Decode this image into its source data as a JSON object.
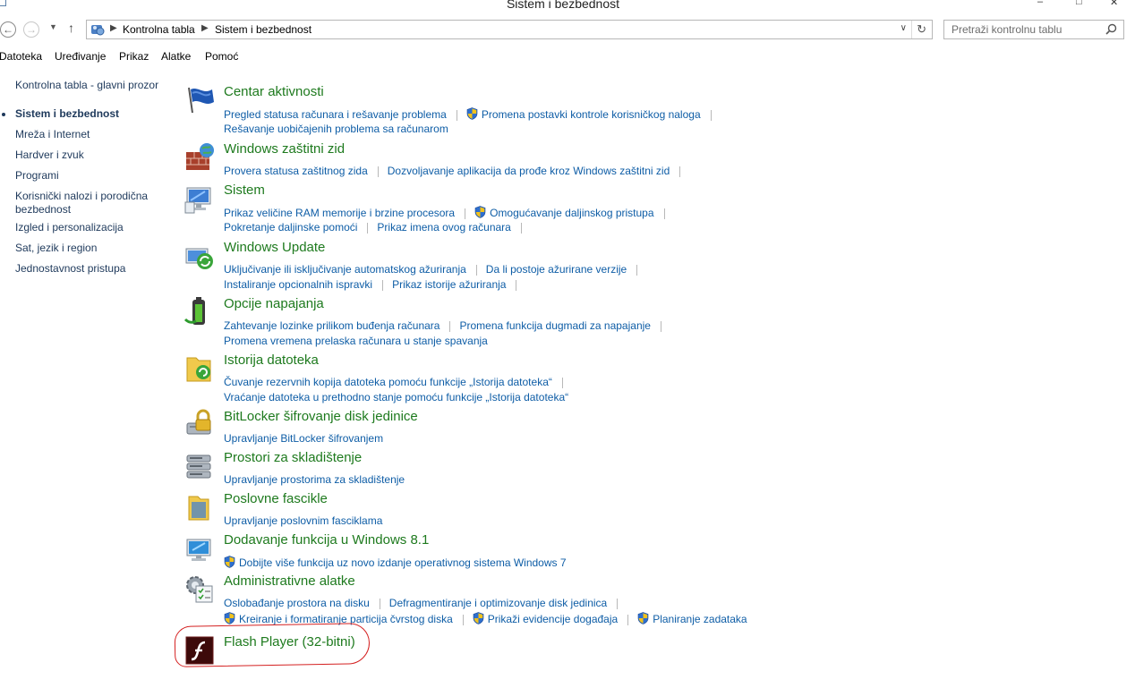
{
  "window": {
    "title": "Sistem i bezbednost",
    "controls": [
      "–",
      "□",
      "✕"
    ]
  },
  "address": {
    "crumbs": [
      "Kontrolna tabla",
      "Sistem i bezbednost"
    ],
    "separator": "▶",
    "dropdown": "∨",
    "refresh": "↻"
  },
  "search": {
    "placeholder": "Pretraži kontrolnu tablu"
  },
  "menu": [
    "Datoteka",
    "Uređivanje",
    "Prikaz",
    "Alatke",
    "Pomoć"
  ],
  "nav": {
    "back": "←",
    "forward": "→",
    "recent": "▼",
    "up": "↑"
  },
  "sidebar": {
    "home": "Kontrolna tabla - glavni prozor",
    "items": [
      {
        "label": "Sistem i bezbednost",
        "current": true
      },
      {
        "label": "Mreža i Internet"
      },
      {
        "label": "Hardver i zvuk"
      },
      {
        "label": "Programi"
      },
      {
        "label": "Korisnički nalozi i porodična bezbednost"
      },
      {
        "label": "Izgled i personalizacija"
      },
      {
        "label": "Sat, jezik i region"
      },
      {
        "label": "Jednostavnost pristupa"
      }
    ]
  },
  "categories": [
    {
      "title": "Centar aktivnosti",
      "icon": "flag-icon",
      "rows": [
        [
          {
            "t": "Pregled statusa računara i rešavanje problema"
          },
          {
            "t": "Promena postavki kontrole korisničkog naloga",
            "shield": true
          }
        ],
        [
          {
            "t": "Rešavanje uobičajenih problema sa računarom"
          }
        ]
      ]
    },
    {
      "title": "Windows zaštitni zid",
      "icon": "firewall-icon",
      "rows": [
        [
          {
            "t": "Provera statusa zaštitnog zida"
          },
          {
            "t": "Dozvoljavanje aplikacija da prođe kroz Windows zaštitni zid"
          }
        ]
      ]
    },
    {
      "title": "Sistem",
      "icon": "system-icon",
      "rows": [
        [
          {
            "t": "Prikaz veličine RAM memorije i brzine procesora"
          },
          {
            "t": "Omogućavanje daljinskog pristupa",
            "shield": true
          }
        ],
        [
          {
            "t": "Pokretanje daljinske pomoći"
          },
          {
            "t": "Prikaz imena ovog računara"
          }
        ]
      ]
    },
    {
      "title": "Windows Update",
      "icon": "windows-update-icon",
      "rows": [
        [
          {
            "t": "Uključivanje ili isključivanje automatskog ažuriranja"
          },
          {
            "t": "Da li postoje ažurirane verzije"
          }
        ],
        [
          {
            "t": "Instaliranje opcionalnih ispravki"
          },
          {
            "t": "Prikaz istorije ažuriranja"
          }
        ]
      ]
    },
    {
      "title": "Opcije napajanja",
      "icon": "power-options-icon",
      "rows": [
        [
          {
            "t": "Zahtevanje lozinke prilikom buđenja računara"
          },
          {
            "t": "Promena funkcija dugmadi za napajanje"
          }
        ],
        [
          {
            "t": "Promena vremena prelaska računara u stanje spavanja"
          }
        ]
      ]
    },
    {
      "title": "Istorija datoteka",
      "icon": "file-history-icon",
      "rows": [
        [
          {
            "t": "Čuvanje rezervnih kopija datoteka pomoću funkcije „Istorija datoteka“"
          }
        ],
        [
          {
            "t": "Vraćanje datoteka u prethodno stanje pomoću funkcije „Istorija datoteka“"
          }
        ]
      ]
    },
    {
      "title": "BitLocker šifrovanje disk jedinice",
      "icon": "bitlocker-icon",
      "rows": [
        [
          {
            "t": "Upravljanje BitLocker šifrovanjem"
          }
        ]
      ]
    },
    {
      "title": "Prostori za skladištenje",
      "icon": "storage-spaces-icon",
      "rows": [
        [
          {
            "t": "Upravljanje prostorima za skladištenje"
          }
        ]
      ]
    },
    {
      "title": "Poslovne fascikle",
      "icon": "work-folders-icon",
      "rows": [
        [
          {
            "t": "Upravljanje poslovnim fasciklama"
          }
        ]
      ]
    },
    {
      "title": "Dodavanje funkcija u Windows 8.1",
      "icon": "add-features-icon",
      "rows": [
        [
          {
            "t": "Dobijte više funkcija uz novo izdanje operativnog sistema Windows 7",
            "shield": true,
            "nopipe": true
          }
        ]
      ]
    },
    {
      "title": "Administrativne alatke",
      "icon": "admin-tools-icon",
      "rows": [
        [
          {
            "t": "Oslobađanje prostora na disku"
          },
          {
            "t": "Defragmentiranje i optimizovanje disk jedinica"
          }
        ],
        [
          {
            "t": "Kreiranje i formatiranje particija čvrstog diska",
            "shield": true
          },
          {
            "t": "Prikaži evidencije događaja",
            "shield": true
          },
          {
            "t": "Planiranje zadataka",
            "shield": true,
            "nopipe": true
          }
        ]
      ]
    },
    {
      "title": "Flash Player (32-bitni)",
      "icon": "flash-player-icon",
      "rows": []
    }
  ]
}
